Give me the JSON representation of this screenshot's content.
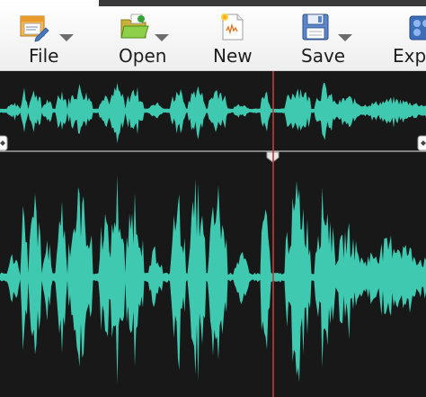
{
  "toolbar": {
    "file_label": "File",
    "open_label": "Open",
    "new_label": "New",
    "save_label": "Save",
    "export_label": "Expo"
  },
  "colors": {
    "waveform": "#3ec9b0",
    "playhead": "#c03b3b",
    "background": "#181818",
    "toolbar_bg": "#f2f2f2"
  },
  "icons": {
    "file": "file-edit-icon",
    "open": "folder-open-icon",
    "new": "new-document-icon",
    "save": "floppy-disk-icon",
    "export": "export-icon",
    "dropdown": "dropdown-arrow-icon",
    "selection_left": "selection-handle-left-icon",
    "selection_right": "selection-handle-right-icon",
    "splitter": "splitter-handle-icon"
  }
}
